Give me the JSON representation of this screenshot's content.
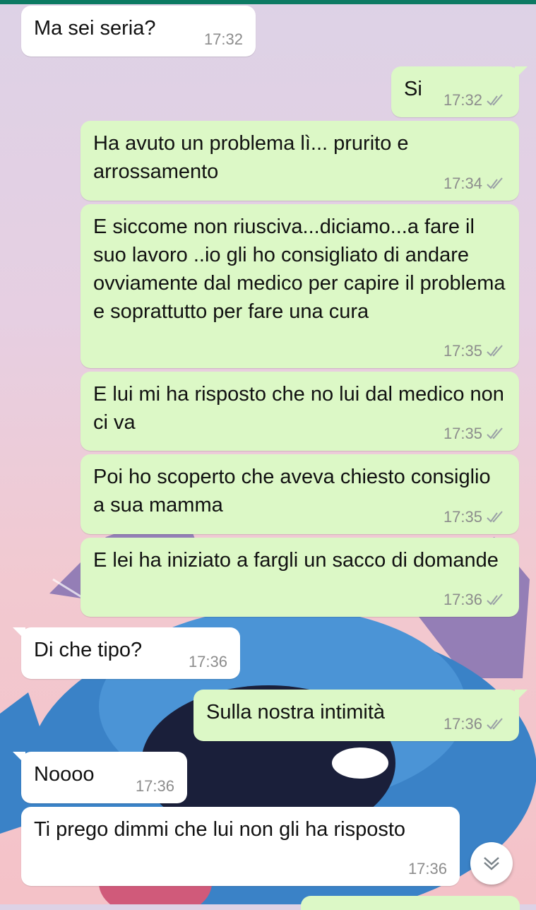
{
  "chat": {
    "messages": [
      {
        "direction": "in",
        "text": "Ma sei seria?",
        "time": "17:32"
      },
      {
        "direction": "out",
        "text": "Si",
        "time": "17:32"
      },
      {
        "direction": "out",
        "text": "Ha avuto un problema lì... prurito e arrossamento",
        "time": "17:34"
      },
      {
        "direction": "out",
        "text": "E siccome non riusciva...diciamo...a fare il suo lavoro ..io gli ho consigliato di andare ovviamente dal medico per capire il problema e soprattutto per fare una cura",
        "time": "17:35"
      },
      {
        "direction": "out",
        "text": "E lui mi ha risposto che no lui dal medico non ci va",
        "time": "17:35"
      },
      {
        "direction": "out",
        "text": "Poi ho scoperto che aveva chiesto consiglio a sua mamma",
        "time": "17:35"
      },
      {
        "direction": "out",
        "text": "E lei ha iniziato a fargli un sacco di domande",
        "time": "17:36"
      },
      {
        "direction": "in",
        "text": "Di che tipo?",
        "time": "17:36"
      },
      {
        "direction": "out",
        "text": "Sulla nostra intimità",
        "time": "17:36"
      },
      {
        "direction": "in",
        "text": "Noooo",
        "time": "17:36"
      },
      {
        "direction": "in",
        "text": "Ti prego dimmi che lui non gli ha risposto",
        "time": "17:36"
      }
    ]
  },
  "theme": {
    "accent": "#0c7a63",
    "outgoing_bubble": "#dcf8c6",
    "incoming_bubble": "#ffffff",
    "tick_color": "#9aa0a6"
  },
  "icons": {
    "read_receipt": "double-check-icon",
    "scroll_down": "chevron-double-down-icon"
  }
}
